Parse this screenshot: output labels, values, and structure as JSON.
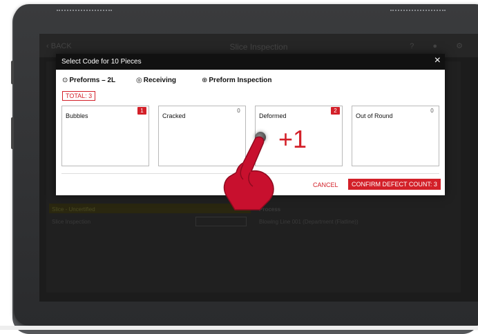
{
  "background_app": {
    "back_label": "BACK",
    "title": "Slice Inspection",
    "row1": "Slice - Uncertified",
    "row2": "Slice Inspection",
    "col_process_label": "Process",
    "col_process_value": "Blowing Line 001 (Department (Flatline))"
  },
  "modal": {
    "title": "Select Code for 10 Pieces",
    "close_icon": "×",
    "breadcrumbs": [
      {
        "icon": "preform-icon",
        "glyph": "⊙",
        "label": "Preforms – 2L"
      },
      {
        "icon": "receiving-icon",
        "glyph": "◎",
        "label": "Receiving"
      },
      {
        "icon": "inspection-icon",
        "glyph": "⊕",
        "label": "Preform Inspection"
      }
    ],
    "total_label": "TOTAL: 3",
    "defects": [
      {
        "label": "Bubbles",
        "count": "1"
      },
      {
        "label": "Cracked",
        "count": "0"
      },
      {
        "label": "Deformed",
        "count": "2"
      },
      {
        "label": "Out of Round",
        "count": "0"
      }
    ],
    "cancel_label": "CANCEL",
    "confirm_label": "CONFIRM DEFECT COUNT: 3"
  },
  "overlay": {
    "plus_label": "+1",
    "hand_icon": "pointing-hand-icon"
  },
  "colors": {
    "accent": "#d32029",
    "header": "#111111"
  }
}
